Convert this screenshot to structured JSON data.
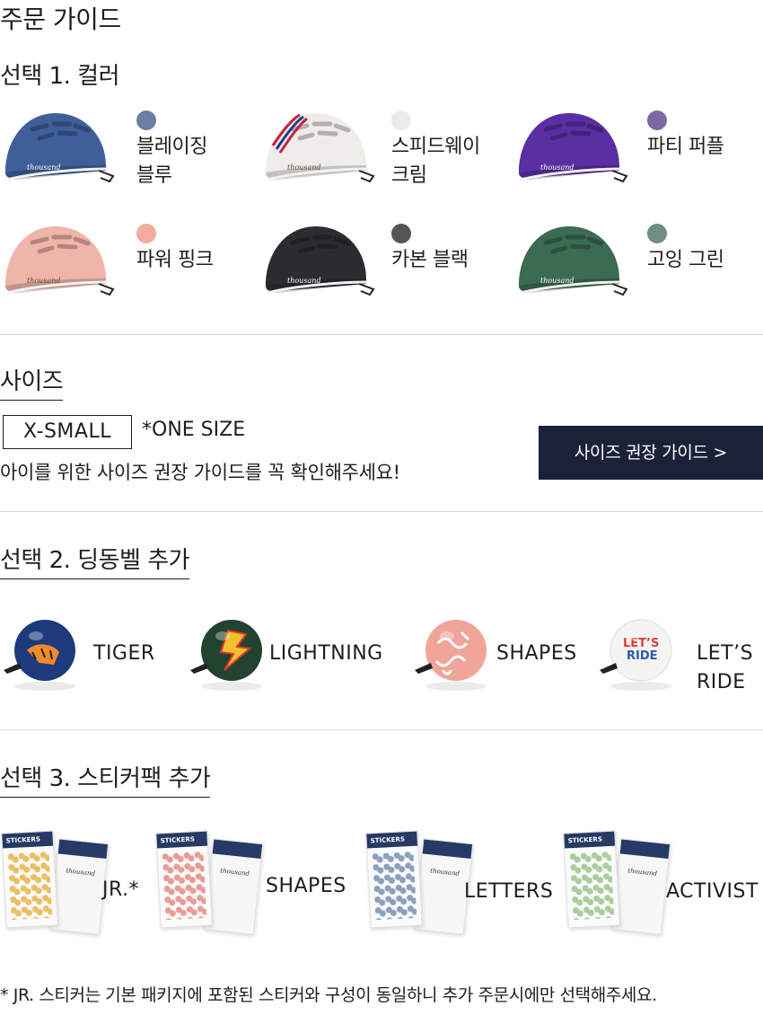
{
  "page": {
    "title": "주문 가이드"
  },
  "color_section": {
    "title": "선택 1.  컬러",
    "options": [
      {
        "name_line1": "블레이징",
        "name_line2": "블루",
        "swatch": "#6a7fa3",
        "helmet": "#3f5f9a",
        "stripe": "none"
      },
      {
        "name_line1": "스피드웨이",
        "name_line2": "크림",
        "swatch": "#ebebeb",
        "helmet": "#eeedea",
        "stripe": "racing"
      },
      {
        "name_line1": "파티 퍼플",
        "name_line2": "",
        "swatch": "#7b68a6",
        "helmet": "#5a2fa3",
        "stripe": "none"
      },
      {
        "name_line1": "파워 핑크",
        "name_line2": "",
        "swatch": "#f2ada0",
        "helmet": "#f0b5a9",
        "stripe": "none"
      },
      {
        "name_line1": "카본 블랙",
        "name_line2": "",
        "swatch": "#545558",
        "helmet": "#2a2c30",
        "stripe": "none"
      },
      {
        "name_line1": "고잉 그린",
        "name_line2": "",
        "swatch": "#6f8f80",
        "helmet": "#3b6b52",
        "stripe": "none"
      }
    ],
    "brand": "thousand"
  },
  "size_section": {
    "title": "사이즈",
    "size_value": "X-SMALL",
    "size_note": "*ONE SIZE",
    "description": "아이를 위한 사이즈 권장 가이드를 꼭 확인해주세요!",
    "guide_button": "사이즈 권장 가이드 >"
  },
  "bell_section": {
    "title": "선택 2. 딩동벨 추가",
    "options": [
      {
        "line1": "TIGER",
        "line2": "",
        "color": "#1d3a7a"
      },
      {
        "line1": "LIGHTNING",
        "line2": "",
        "color": "#22432f"
      },
      {
        "line1": "SHAPES",
        "line2": "",
        "color": "#f1a49a"
      },
      {
        "line1": "LET’S",
        "line2": "RIDE",
        "color": "#f4f4f2"
      }
    ]
  },
  "sticker_section": {
    "title": "선택 3.  스티커팩 추가",
    "options": [
      {
        "label": "JR.*",
        "accent": "#e9b44a"
      },
      {
        "label": "SHAPES",
        "accent": "#e68b86"
      },
      {
        "label": "LETTERS",
        "accent": "#7a8fb5"
      },
      {
        "label": "ACTIVIST",
        "accent": "#9cc48e"
      }
    ],
    "pack_brand": "STICKERS",
    "pack_sub": "thousand"
  },
  "footnote": "* JR. 스티커는 기본 패키지에 포함된 스티커와 구성이 동일하니 추가 주문시에만 선택해주세요."
}
